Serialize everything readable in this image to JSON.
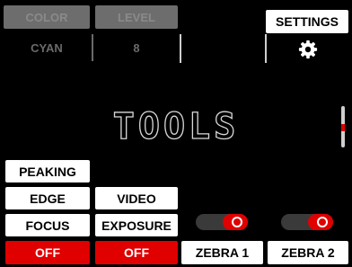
{
  "header": {
    "color_label": "COLOR",
    "level_label": "LEVEL",
    "color_value": "CYAN",
    "level_value": "8",
    "settings_label": "SETTINGS"
  },
  "title": "TOOLS",
  "buttons": {
    "peaking": "PEAKING",
    "edge": "EDGE",
    "video": "VIDEO",
    "focus": "FOCUS",
    "exposure": "EXPOSURE",
    "focus_state": "OFF",
    "exposure_state": "OFF",
    "zebra1": "ZEBRA 1",
    "zebra2": "ZEBRA 2"
  },
  "toggles": {
    "zebra1": "on",
    "zebra2": "on"
  },
  "scroll": {
    "position": 0.5
  },
  "colors": {
    "accent": "#e00000",
    "dim": "#6d6d6d"
  },
  "icons": {
    "settings": "gear-icon"
  }
}
